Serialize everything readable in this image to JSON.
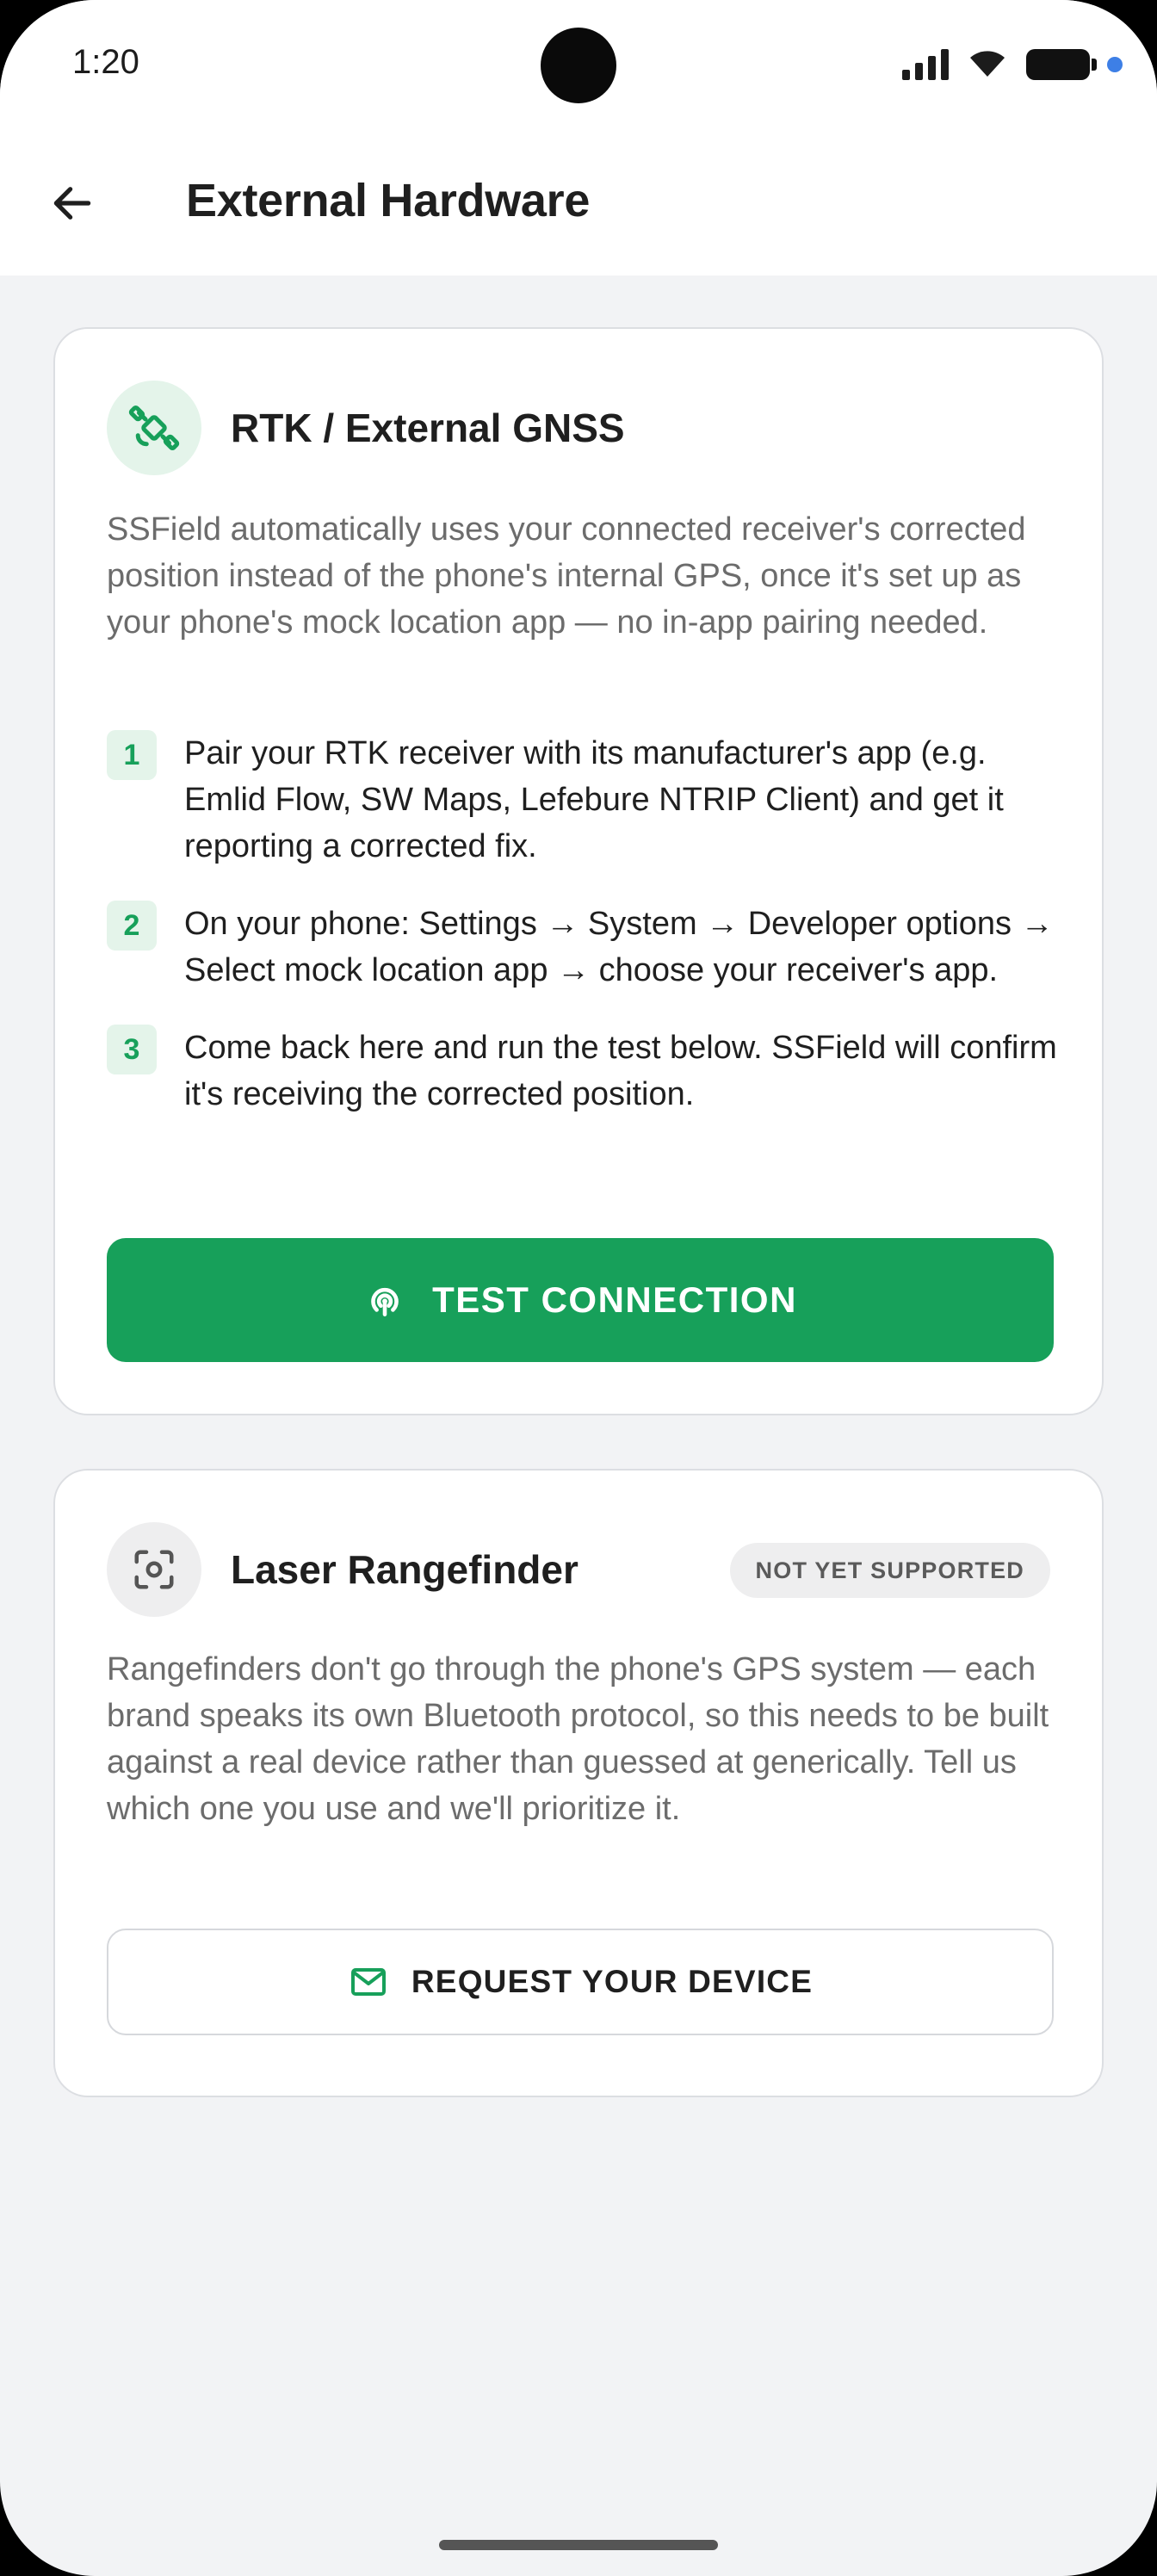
{
  "status_bar": {
    "time": "1:20",
    "icons": [
      "signal-icon",
      "wifi-icon",
      "battery-icon",
      "notification-dot"
    ]
  },
  "app_bar": {
    "back_icon": "arrow-left-icon",
    "title": "External Hardware"
  },
  "rtk_card": {
    "icon": "satellite-icon",
    "title": "RTK / External GNSS",
    "description": "SSField automatically uses your connected receiver's corrected position instead of the phone's internal GPS, once it's set up as your phone's mock location app — no in-app pairing needed.",
    "steps": [
      {
        "number": "1",
        "text": "Pair your RTK receiver with its manufacturer's app (e.g. Emlid Flow, SW Maps, Lefebure NTRIP Client) and get it reporting a corrected fix."
      },
      {
        "number": "2",
        "text": "On your phone: Settings → System → Developer options → Select mock location app → choose your receiver's app."
      },
      {
        "number": "3",
        "text": "Come back here and run the test below. SSField will confirm it's receiving the corrected position."
      }
    ],
    "button_icon": "broadcast-icon",
    "button_label": "TEST CONNECTION"
  },
  "laser_card": {
    "icon": "scan-icon",
    "title": "Laser Rangefinder",
    "badge": "NOT YET SUPPORTED",
    "description": "Rangefinders don't go through the phone's GPS system — each brand speaks its own Bluetooth protocol, so this needs to be built against a real device rather than guessed at generically. Tell us which one you use and we'll prioritize it.",
    "button_icon": "mail-icon",
    "button_label": "REQUEST YOUR DEVICE"
  },
  "colors": {
    "accent": "#17a05a",
    "accent_light": "#e4f4ea",
    "background": "#f2f3f5",
    "text_primary": "#1f1f1f",
    "text_secondary": "#6c6c6c"
  }
}
